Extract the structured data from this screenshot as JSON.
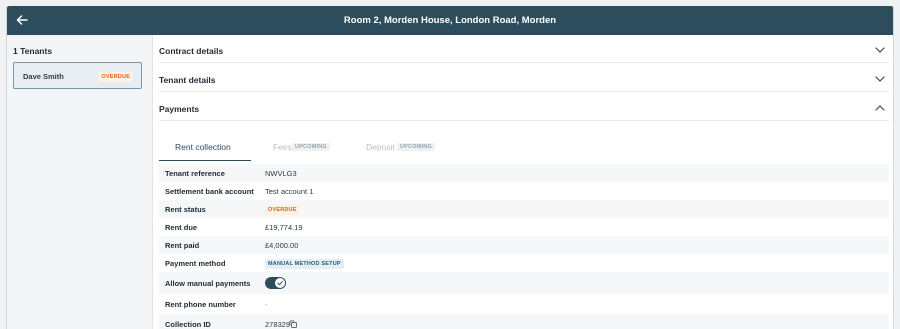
{
  "header": {
    "title": "Room 2, Morden House, London Road, Morden"
  },
  "sidebar": {
    "title": "1 Tenants",
    "tenants": [
      {
        "name": "Dave Smith",
        "status": "OVERDUE"
      }
    ]
  },
  "sections": {
    "contract": "Contract details",
    "tenant": "Tenant details",
    "payments": "Payments"
  },
  "tabs": {
    "rent": "Rent collection",
    "fees": "Fees",
    "fees_badge": "UPCOMING",
    "deposit": "Deposit",
    "deposit_badge": "UPCOMING"
  },
  "details": {
    "tenant_reference": {
      "label": "Tenant reference",
      "value": "NWVLG3"
    },
    "settlement_account": {
      "label": "Settlement bank account",
      "value": "Test account 1"
    },
    "rent_status": {
      "label": "Rent status",
      "value": "OVERDUE"
    },
    "rent_due": {
      "label": "Rent due",
      "value": "£19,774.19"
    },
    "rent_paid": {
      "label": "Rent paid",
      "value": "£4,000.00"
    },
    "payment_method": {
      "label": "Payment method",
      "value": "MANUAL METHOD SETUP"
    },
    "allow_manual": {
      "label": "Allow manual payments",
      "enabled": true
    },
    "rent_phone": {
      "label": "Rent phone number",
      "value": "-"
    },
    "collection_id": {
      "label": "Collection ID",
      "value": "278329"
    }
  },
  "colors": {
    "header_bg": "#2e4d5c",
    "overdue": "#d9621c",
    "accent": "#2e4d5c"
  },
  "icons": {
    "back": "arrow-left-icon",
    "collapse": "chevron-down-icon",
    "expand": "chevron-up-icon",
    "copy": "copy-icon",
    "toggle_check": "check-icon"
  }
}
